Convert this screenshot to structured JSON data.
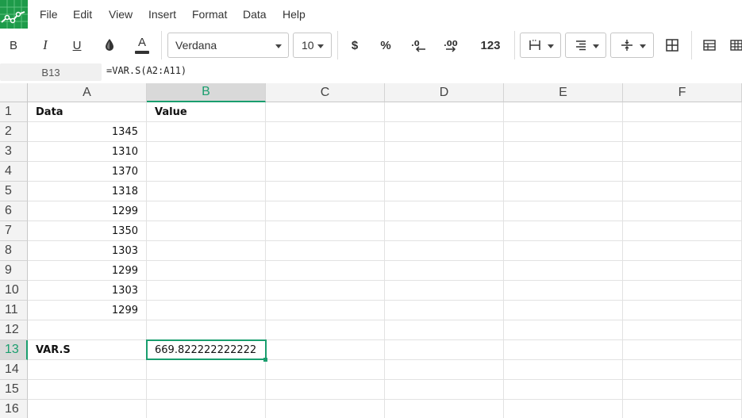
{
  "menu": [
    "File",
    "Edit",
    "View",
    "Insert",
    "Format",
    "Data",
    "Help"
  ],
  "toolbar": {
    "bold": "B",
    "italic": "I",
    "underline": "U",
    "text_color": "A",
    "font_family": "Verdana",
    "font_size": "10",
    "currency": "$",
    "percent": "%",
    "decrease_decimals": ".0",
    "increase_decimals": ".00",
    "number_format": "123",
    "text_color_value": "#333333"
  },
  "formula_bar": {
    "cell_ref": "B13",
    "formula": "=VAR.S(A2:A11)"
  },
  "columns": [
    "A",
    "B",
    "C",
    "D",
    "E",
    "F"
  ],
  "active_column": "B",
  "active_row": "13",
  "rows": [
    {
      "n": "1",
      "a": "Data",
      "b": "Value"
    },
    {
      "n": "2",
      "a": "1345",
      "b": ""
    },
    {
      "n": "3",
      "a": "1310",
      "b": ""
    },
    {
      "n": "4",
      "a": "1370",
      "b": ""
    },
    {
      "n": "5",
      "a": "1318",
      "b": ""
    },
    {
      "n": "6",
      "a": "1299",
      "b": ""
    },
    {
      "n": "7",
      "a": "1350",
      "b": ""
    },
    {
      "n": "8",
      "a": "1303",
      "b": ""
    },
    {
      "n": "9",
      "a": "1299",
      "b": ""
    },
    {
      "n": "10",
      "a": "1303",
      "b": ""
    },
    {
      "n": "11",
      "a": "1299",
      "b": ""
    },
    {
      "n": "12",
      "a": "",
      "b": ""
    },
    {
      "n": "13",
      "a": "VAR.S",
      "b": "669.822222222222"
    },
    {
      "n": "14",
      "a": "",
      "b": ""
    },
    {
      "n": "15",
      "a": "",
      "b": ""
    },
    {
      "n": "16",
      "a": "",
      "b": ""
    }
  ],
  "colors": {
    "accent": "#1a9e6e",
    "logo": "#1e9b4a"
  }
}
